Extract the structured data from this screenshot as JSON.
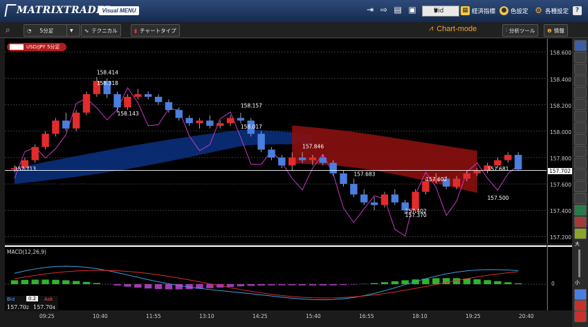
{
  "app": {
    "logo_text": "MATRIXTRADER",
    "visual_menu": "Visual MENU"
  },
  "topbar": {
    "bid_select": "Bid",
    "buttons": [
      {
        "label": "経済指標"
      },
      {
        "label": "色設定"
      },
      {
        "label": "各種設定"
      }
    ]
  },
  "toolbar2": {
    "timeframe": "5分足",
    "technical": "テクニカル",
    "chart_type": "チャートタイプ",
    "chart_mode": "Chart-mode",
    "analysis_tools": "分析ツール",
    "info": "情報"
  },
  "instrument": {
    "label": "USD/JPY 5分足"
  },
  "price_axis": {
    "ticks": [
      "158.600",
      "158.400",
      "158.200",
      "158.000",
      "157.800",
      "157.600",
      "157.400",
      "157.200"
    ],
    "current_price": "157.702"
  },
  "macd": {
    "label": "MACD(12,26,9)",
    "zero_label": "0"
  },
  "time_axis": {
    "labels": [
      "09:25",
      "10:40",
      "11:55",
      "13:10",
      "14:25",
      "15:40",
      "16:55",
      "18:10",
      "19:25",
      "20:40"
    ]
  },
  "bid_ask": {
    "bid_label": "Bid",
    "spread": "0.2",
    "ask_label": "Ask",
    "bid_price_main": "157.70",
    "bid_price_small": "2",
    "ask_price_main": "157.70",
    "ask_price_small": "4"
  },
  "right_tools": {
    "zoom_in": "大",
    "zoom_out": "小"
  },
  "colors": {
    "bull": "#e32b2b",
    "bear": "#4a7fe0",
    "cloud_blue": "#0a2f7a",
    "cloud_red": "#8a0f0f",
    "lagging": "#c43ac8",
    "macd": "#3aa0e0",
    "signal": "#e02a2a",
    "hist_pos": "#2db52d",
    "hist_neg": "#a23ab5",
    "chart_mode": "#f6a52a"
  },
  "chart_data": {
    "type": "candlestick",
    "ylim": [
      157.15,
      158.7
    ],
    "price_labels": [
      {
        "value": "158.414"
      },
      {
        "value": "158.318"
      },
      {
        "value": "158.143"
      },
      {
        "value": "158.157"
      },
      {
        "value": "158.017"
      },
      {
        "value": "157.846"
      },
      {
        "value": "157.713"
      },
      {
        "value": "157.683"
      },
      {
        "value": "157.681"
      },
      {
        "value": "157.602"
      },
      {
        "value": "157.500"
      },
      {
        "value": "157.402"
      },
      {
        "value": "157.370"
      }
    ],
    "candles": [
      [
        157.71,
        157.74,
        157.69,
        157.72
      ],
      [
        157.72,
        157.8,
        157.7,
        157.78
      ],
      [
        157.78,
        157.9,
        157.76,
        157.88
      ],
      [
        157.88,
        158.0,
        157.86,
        157.98
      ],
      [
        157.98,
        158.1,
        157.96,
        158.08
      ],
      [
        158.08,
        158.14,
        158.0,
        158.02
      ],
      [
        158.02,
        158.16,
        158.0,
        158.14
      ],
      [
        158.14,
        158.3,
        158.12,
        158.28
      ],
      [
        158.28,
        158.41,
        158.26,
        158.38
      ],
      [
        158.38,
        158.4,
        158.25,
        158.28
      ],
      [
        158.28,
        158.3,
        158.14,
        158.18
      ],
      [
        158.18,
        158.28,
        158.16,
        158.26
      ],
      [
        158.26,
        158.32,
        158.24,
        158.28
      ],
      [
        158.28,
        158.3,
        158.24,
        158.26
      ],
      [
        158.26,
        158.28,
        158.2,
        158.22
      ],
      [
        158.22,
        158.24,
        158.14,
        158.16
      ],
      [
        158.16,
        158.18,
        158.08,
        158.1
      ],
      [
        158.1,
        158.12,
        158.04,
        158.06
      ],
      [
        158.06,
        158.1,
        158.02,
        158.08
      ],
      [
        158.08,
        158.12,
        158.02,
        158.04
      ],
      [
        158.04,
        158.08,
        158.02,
        158.06
      ],
      [
        158.06,
        158.12,
        158.04,
        158.1
      ],
      [
        158.1,
        158.14,
        158.06,
        158.08
      ],
      [
        158.08,
        158.1,
        157.96,
        157.98
      ],
      [
        157.98,
        158.0,
        157.84,
        157.86
      ],
      [
        157.86,
        157.88,
        157.78,
        157.8
      ],
      [
        157.8,
        157.82,
        157.72,
        157.74
      ],
      [
        157.74,
        157.84,
        157.7,
        157.8
      ],
      [
        157.8,
        157.84,
        157.76,
        157.78
      ],
      [
        157.78,
        157.82,
        157.74,
        157.8
      ],
      [
        157.8,
        157.82,
        157.74,
        157.76
      ],
      [
        157.76,
        157.78,
        157.66,
        157.68
      ],
      [
        157.68,
        157.7,
        157.58,
        157.6
      ],
      [
        157.6,
        157.64,
        157.5,
        157.52
      ],
      [
        157.52,
        157.56,
        157.44,
        157.46
      ],
      [
        157.46,
        157.5,
        157.4,
        157.44
      ],
      [
        157.44,
        157.54,
        157.42,
        157.52
      ],
      [
        157.52,
        157.56,
        157.44,
        157.46
      ],
      [
        157.46,
        157.48,
        157.37,
        157.4
      ],
      [
        157.4,
        157.56,
        157.38,
        157.54
      ],
      [
        157.54,
        157.64,
        157.52,
        157.62
      ],
      [
        157.62,
        157.68,
        157.6,
        157.64
      ],
      [
        157.64,
        157.66,
        157.56,
        157.58
      ],
      [
        157.58,
        157.66,
        157.56,
        157.64
      ],
      [
        157.64,
        157.7,
        157.62,
        157.68
      ],
      [
        157.68,
        157.72,
        157.66,
        157.7
      ],
      [
        157.7,
        157.76,
        157.68,
        157.74
      ],
      [
        157.74,
        157.8,
        157.72,
        157.78
      ],
      [
        157.78,
        157.84,
        157.76,
        157.82
      ],
      [
        157.82,
        157.84,
        157.7,
        157.71
      ]
    ]
  }
}
